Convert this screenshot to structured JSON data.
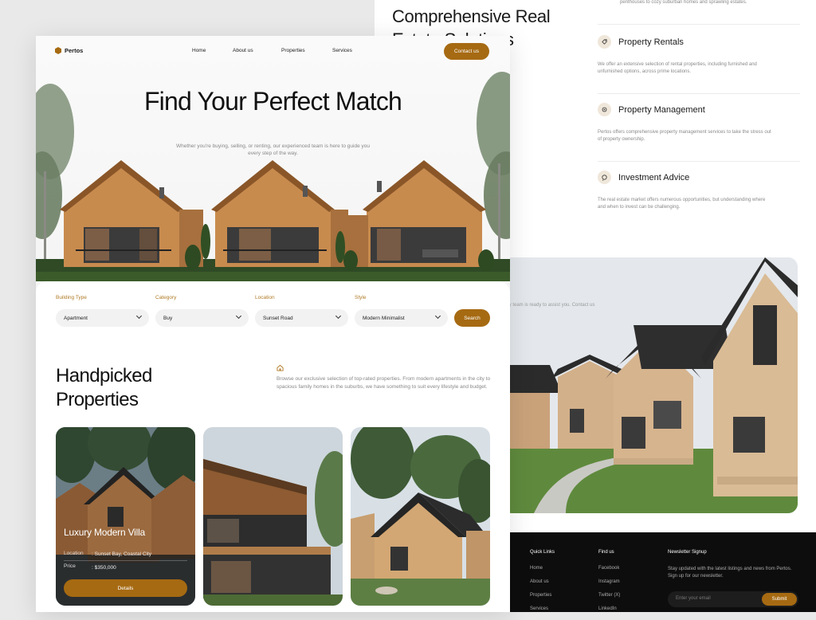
{
  "back_panel": {
    "title": "Comprehensive Real Estate Solutions",
    "top_note": "penthouses to cozy suburban homes and sprawling estates.",
    "services": [
      {
        "title": "Property Rentals",
        "desc": "We offer an extensive selection of rental properties, including furnished and unfurnished options, across prime locations.",
        "icon": "key-tag-icon"
      },
      {
        "title": "Property Management",
        "desc": "Pertos offers comprehensive property management services to take the stress out of property ownership.",
        "icon": "gear-icon"
      },
      {
        "title": "Investment Advice",
        "desc": "The real estate market offers numerous opportunities, but understanding where and when to invest can be challenging.",
        "icon": "chat-icon"
      }
    ],
    "contact_snippet": "dly team is ready to assist you. Contact us"
  },
  "footer": {
    "quick_links_heading": "Quick Links",
    "quick_links": [
      "Home",
      "About us",
      "Properties",
      "Services"
    ],
    "find_us_heading": "Find us",
    "find_us": [
      "Facebook",
      "Instagram",
      "Twitter (X)",
      "LinkedIn"
    ],
    "newsletter_heading": "Newsletter Signup",
    "newsletter_text": "Stay updated with the latest listings and news from Pertos. Sign up for our newsletter.",
    "email_placeholder": "Enter your email",
    "submit_label": "Submit"
  },
  "nav": {
    "brand": "Pertos",
    "links": [
      "Home",
      "About us",
      "Properties",
      "Services"
    ],
    "contact_label": "Contact us"
  },
  "hero": {
    "title": "Find Your Perfect Match",
    "subtitle": "Whether you're buying, selling, or renting, our experienced team is here to guide you every step of the way."
  },
  "filters": [
    {
      "label": "Building Type",
      "value": "Apartment"
    },
    {
      "label": "Category",
      "value": "Buy"
    },
    {
      "label": "Location",
      "value": "Sunset Road"
    },
    {
      "label": "Style",
      "value": "Modern Minimalist"
    }
  ],
  "search_label": "Search",
  "handpicked": {
    "title": "Handpicked Properties",
    "desc": "Browse our exclusive selection of top-rated properties. From modern apartments in the city to spacious family homes in the suburbs, we have something to suit every lifestyle and budget."
  },
  "featured": {
    "name": "Luxury Modern Villa",
    "location_label": "Location",
    "location_value": ": Sunset Bay, Coastal City",
    "price_label": "Price",
    "price_value": ": $350,000",
    "details_label": "Details"
  },
  "colors": {
    "accent": "#a66a12",
    "label": "#b07a25",
    "dark": "#0d0d0d"
  }
}
